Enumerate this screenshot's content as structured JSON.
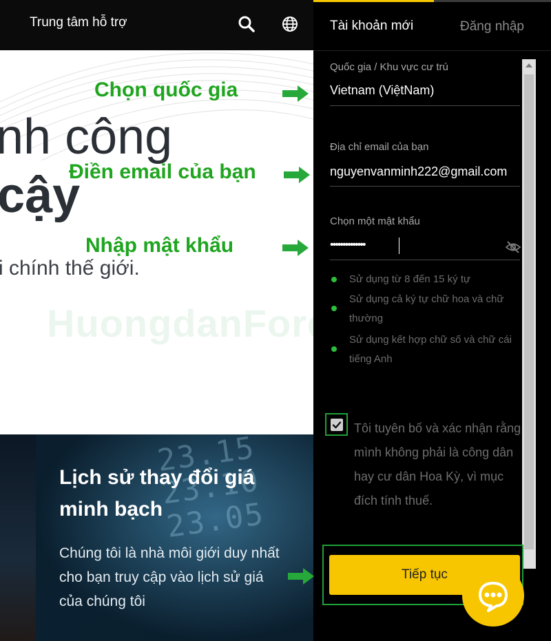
{
  "topnav": {
    "support_label": "Trung tâm hỗ trợ",
    "icons": [
      "search-icon",
      "globe-icon"
    ]
  },
  "hero": {
    "line1": "nh công",
    "line2": "cậy",
    "subtitle": "i chính thế giới."
  },
  "feature": {
    "title": "Lịch sử thay đổi giá minh bạch",
    "description": "Chúng tôi là nhà môi giới duy nhất cho bạn truy cập vào lịch sử giá của chúng tôi",
    "board_digits": "23.15\n23.10\n23.05"
  },
  "signup": {
    "tabs": {
      "new_account": "Tài khoản mới",
      "login": "Đăng nhập"
    },
    "country": {
      "label": "Quốc gia / Khu vực cư trú",
      "value": "Vietnam (ViệtNam)"
    },
    "email": {
      "label": "Địa chỉ email của bạn",
      "value": "nguyenvanminh222@gmail.com"
    },
    "password": {
      "label": "Chọn một mật khẩu",
      "value": "••••••••••••••"
    },
    "password_rules": [
      "Sử dụng từ 8 đến 15 ký tự",
      "Sử dụng cả ký tự chữ hoa và chữ thường",
      "Sử dụng kết hợp chữ số và chữ cái tiếng Anh"
    ],
    "declaration": {
      "checked": true,
      "text": "Tôi tuyên bố và xác nhận rằng mình không phải là công dân hay cư dân Hoa Kỳ, vì mục đích tính thuế."
    },
    "continue_label": "Tiếp tục"
  },
  "annotations": {
    "choose_country": "Chọn quốc gia",
    "enter_email": "Điền email của bạn",
    "enter_password": "Nhập mật khẩu"
  },
  "watermark": "HuongdanForex.com",
  "colors": {
    "accent": "#f7c600",
    "annotation_green": "#1fa51f",
    "rule_dot": "#2bbf3a",
    "panel_bg": "#000000"
  }
}
